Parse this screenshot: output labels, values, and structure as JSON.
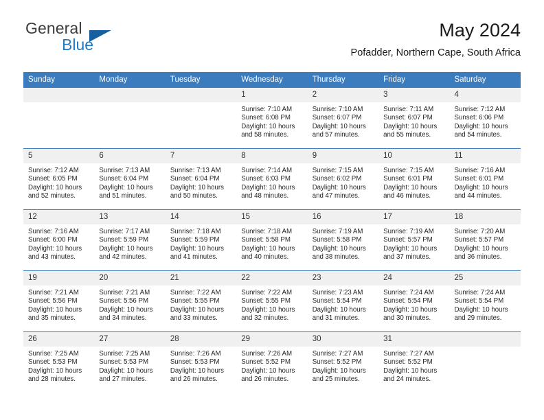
{
  "brand": {
    "name_part1": "General",
    "name_part2": "Blue",
    "flag_icon": "flag-triangle-icon"
  },
  "header": {
    "title": "May 2024",
    "location": "Pofadder, Northern Cape, South Africa"
  },
  "colors": {
    "header_blue": "#3a7cbe",
    "logo_blue": "#1f7ac4",
    "flag_blue": "#17609f",
    "daynum_band": "#f0f0f0"
  },
  "weekday_headers": [
    "Sunday",
    "Monday",
    "Tuesday",
    "Wednesday",
    "Thursday",
    "Friday",
    "Saturday"
  ],
  "labels": {
    "sunrise_prefix": "Sunrise:",
    "sunset_prefix": "Sunset:",
    "daylight_prefix": "Daylight:"
  },
  "weeks": [
    [
      {
        "day": "",
        "empty": true
      },
      {
        "day": "",
        "empty": true
      },
      {
        "day": "",
        "empty": true
      },
      {
        "day": "1",
        "sunrise": "Sunrise: 7:10 AM",
        "sunset": "Sunset: 6:08 PM",
        "daylight_line1": "Daylight: 10 hours",
        "daylight_line2": "and 58 minutes."
      },
      {
        "day": "2",
        "sunrise": "Sunrise: 7:10 AM",
        "sunset": "Sunset: 6:07 PM",
        "daylight_line1": "Daylight: 10 hours",
        "daylight_line2": "and 57 minutes."
      },
      {
        "day": "3",
        "sunrise": "Sunrise: 7:11 AM",
        "sunset": "Sunset: 6:07 PM",
        "daylight_line1": "Daylight: 10 hours",
        "daylight_line2": "and 55 minutes."
      },
      {
        "day": "4",
        "sunrise": "Sunrise: 7:12 AM",
        "sunset": "Sunset: 6:06 PM",
        "daylight_line1": "Daylight: 10 hours",
        "daylight_line2": "and 54 minutes."
      }
    ],
    [
      {
        "day": "5",
        "sunrise": "Sunrise: 7:12 AM",
        "sunset": "Sunset: 6:05 PM",
        "daylight_line1": "Daylight: 10 hours",
        "daylight_line2": "and 52 minutes."
      },
      {
        "day": "6",
        "sunrise": "Sunrise: 7:13 AM",
        "sunset": "Sunset: 6:04 PM",
        "daylight_line1": "Daylight: 10 hours",
        "daylight_line2": "and 51 minutes."
      },
      {
        "day": "7",
        "sunrise": "Sunrise: 7:13 AM",
        "sunset": "Sunset: 6:04 PM",
        "daylight_line1": "Daylight: 10 hours",
        "daylight_line2": "and 50 minutes."
      },
      {
        "day": "8",
        "sunrise": "Sunrise: 7:14 AM",
        "sunset": "Sunset: 6:03 PM",
        "daylight_line1": "Daylight: 10 hours",
        "daylight_line2": "and 48 minutes."
      },
      {
        "day": "9",
        "sunrise": "Sunrise: 7:15 AM",
        "sunset": "Sunset: 6:02 PM",
        "daylight_line1": "Daylight: 10 hours",
        "daylight_line2": "and 47 minutes."
      },
      {
        "day": "10",
        "sunrise": "Sunrise: 7:15 AM",
        "sunset": "Sunset: 6:01 PM",
        "daylight_line1": "Daylight: 10 hours",
        "daylight_line2": "and 46 minutes."
      },
      {
        "day": "11",
        "sunrise": "Sunrise: 7:16 AM",
        "sunset": "Sunset: 6:01 PM",
        "daylight_line1": "Daylight: 10 hours",
        "daylight_line2": "and 44 minutes."
      }
    ],
    [
      {
        "day": "12",
        "sunrise": "Sunrise: 7:16 AM",
        "sunset": "Sunset: 6:00 PM",
        "daylight_line1": "Daylight: 10 hours",
        "daylight_line2": "and 43 minutes."
      },
      {
        "day": "13",
        "sunrise": "Sunrise: 7:17 AM",
        "sunset": "Sunset: 5:59 PM",
        "daylight_line1": "Daylight: 10 hours",
        "daylight_line2": "and 42 minutes."
      },
      {
        "day": "14",
        "sunrise": "Sunrise: 7:18 AM",
        "sunset": "Sunset: 5:59 PM",
        "daylight_line1": "Daylight: 10 hours",
        "daylight_line2": "and 41 minutes."
      },
      {
        "day": "15",
        "sunrise": "Sunrise: 7:18 AM",
        "sunset": "Sunset: 5:58 PM",
        "daylight_line1": "Daylight: 10 hours",
        "daylight_line2": "and 40 minutes."
      },
      {
        "day": "16",
        "sunrise": "Sunrise: 7:19 AM",
        "sunset": "Sunset: 5:58 PM",
        "daylight_line1": "Daylight: 10 hours",
        "daylight_line2": "and 38 minutes."
      },
      {
        "day": "17",
        "sunrise": "Sunrise: 7:19 AM",
        "sunset": "Sunset: 5:57 PM",
        "daylight_line1": "Daylight: 10 hours",
        "daylight_line2": "and 37 minutes."
      },
      {
        "day": "18",
        "sunrise": "Sunrise: 7:20 AM",
        "sunset": "Sunset: 5:57 PM",
        "daylight_line1": "Daylight: 10 hours",
        "daylight_line2": "and 36 minutes."
      }
    ],
    [
      {
        "day": "19",
        "sunrise": "Sunrise: 7:21 AM",
        "sunset": "Sunset: 5:56 PM",
        "daylight_line1": "Daylight: 10 hours",
        "daylight_line2": "and 35 minutes."
      },
      {
        "day": "20",
        "sunrise": "Sunrise: 7:21 AM",
        "sunset": "Sunset: 5:56 PM",
        "daylight_line1": "Daylight: 10 hours",
        "daylight_line2": "and 34 minutes."
      },
      {
        "day": "21",
        "sunrise": "Sunrise: 7:22 AM",
        "sunset": "Sunset: 5:55 PM",
        "daylight_line1": "Daylight: 10 hours",
        "daylight_line2": "and 33 minutes."
      },
      {
        "day": "22",
        "sunrise": "Sunrise: 7:22 AM",
        "sunset": "Sunset: 5:55 PM",
        "daylight_line1": "Daylight: 10 hours",
        "daylight_line2": "and 32 minutes."
      },
      {
        "day": "23",
        "sunrise": "Sunrise: 7:23 AM",
        "sunset": "Sunset: 5:54 PM",
        "daylight_line1": "Daylight: 10 hours",
        "daylight_line2": "and 31 minutes."
      },
      {
        "day": "24",
        "sunrise": "Sunrise: 7:24 AM",
        "sunset": "Sunset: 5:54 PM",
        "daylight_line1": "Daylight: 10 hours",
        "daylight_line2": "and 30 minutes."
      },
      {
        "day": "25",
        "sunrise": "Sunrise: 7:24 AM",
        "sunset": "Sunset: 5:54 PM",
        "daylight_line1": "Daylight: 10 hours",
        "daylight_line2": "and 29 minutes."
      }
    ],
    [
      {
        "day": "26",
        "sunrise": "Sunrise: 7:25 AM",
        "sunset": "Sunset: 5:53 PM",
        "daylight_line1": "Daylight: 10 hours",
        "daylight_line2": "and 28 minutes."
      },
      {
        "day": "27",
        "sunrise": "Sunrise: 7:25 AM",
        "sunset": "Sunset: 5:53 PM",
        "daylight_line1": "Daylight: 10 hours",
        "daylight_line2": "and 27 minutes."
      },
      {
        "day": "28",
        "sunrise": "Sunrise: 7:26 AM",
        "sunset": "Sunset: 5:53 PM",
        "daylight_line1": "Daylight: 10 hours",
        "daylight_line2": "and 26 minutes."
      },
      {
        "day": "29",
        "sunrise": "Sunrise: 7:26 AM",
        "sunset": "Sunset: 5:52 PM",
        "daylight_line1": "Daylight: 10 hours",
        "daylight_line2": "and 26 minutes."
      },
      {
        "day": "30",
        "sunrise": "Sunrise: 7:27 AM",
        "sunset": "Sunset: 5:52 PM",
        "daylight_line1": "Daylight: 10 hours",
        "daylight_line2": "and 25 minutes."
      },
      {
        "day": "31",
        "sunrise": "Sunrise: 7:27 AM",
        "sunset": "Sunset: 5:52 PM",
        "daylight_line1": "Daylight: 10 hours",
        "daylight_line2": "and 24 minutes."
      },
      {
        "day": "",
        "empty": true
      }
    ]
  ]
}
